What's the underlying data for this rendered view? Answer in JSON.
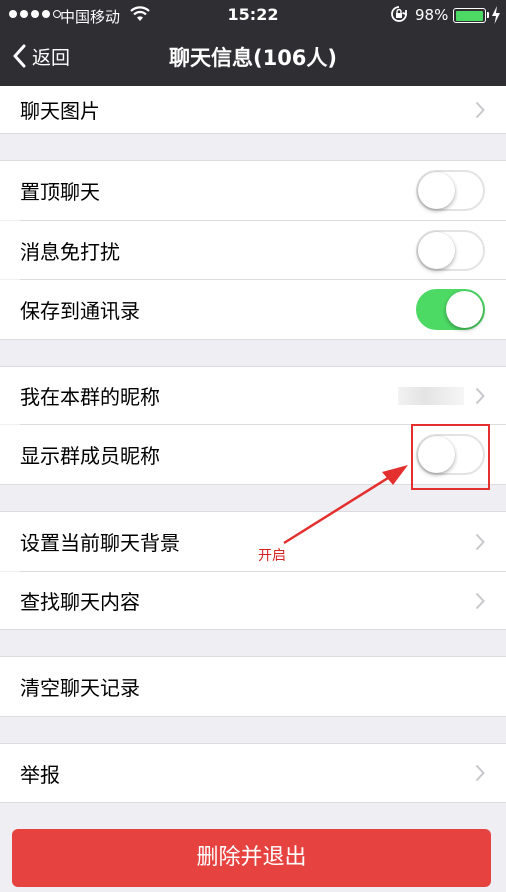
{
  "status_bar": {
    "carrier": "中国移动",
    "time": "15:22",
    "battery_percent": "98%",
    "battery_level": 0.98,
    "signal_bars": 4
  },
  "nav": {
    "back_label": "返回",
    "title": "聊天信息(106人)"
  },
  "rows": {
    "chat_images": "聊天图片",
    "pin_chat": "置顶聊天",
    "mute": "消息免打扰",
    "save_contacts": "保存到通讯录",
    "my_group_nickname": "我在本群的昵称",
    "show_member_names": "显示群成员昵称",
    "set_background": "设置当前聊天背景",
    "search_history": "查找聊天内容",
    "clear_history": "清空聊天记录",
    "report": "举报"
  },
  "toggles": {
    "pin_chat": false,
    "mute": false,
    "save_contacts": true,
    "show_member_names": false
  },
  "annotation": {
    "text": "开启",
    "color": "#d8221f"
  },
  "delete_button": "删除并退出",
  "colors": {
    "nav_bg": "#2e2e33",
    "toggle_on": "#4cd964",
    "delete_bg": "#e64340"
  }
}
